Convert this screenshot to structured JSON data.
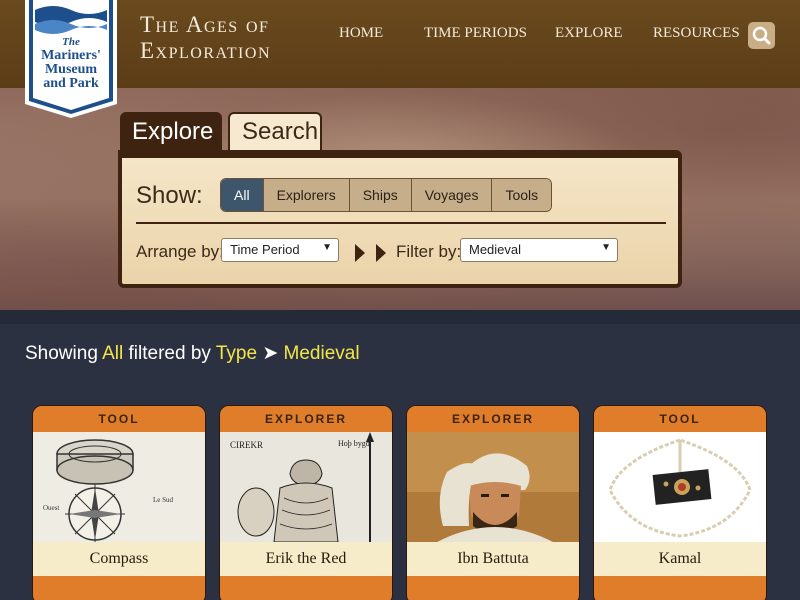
{
  "logo": {
    "lines": [
      "The",
      "Mariners'",
      "Museum",
      "and Park"
    ]
  },
  "site_title": {
    "line1": "The Ages of",
    "line2": "Exploration"
  },
  "nav": {
    "items": [
      {
        "label": "HOME"
      },
      {
        "label": "TIME PERIODS"
      },
      {
        "label": "EXPLORE"
      },
      {
        "label": "RESOURCES"
      }
    ],
    "search_icon": "search-icon"
  },
  "tabs": {
    "explore": "Explore",
    "search": "Search"
  },
  "panel": {
    "show_label": "Show:",
    "filters": [
      "All",
      "Explorers",
      "Ships",
      "Voyages",
      "Tools"
    ],
    "active_filter": "All",
    "arrange_label": "Arrange by:",
    "arrange_value": "Time Period",
    "filter_label": "Filter by:",
    "filter_value": "Medieval"
  },
  "results": {
    "prefix": "Showing",
    "show": "All",
    "middle": "filtered by",
    "type": "Type",
    "separator": "➤",
    "period": "Medieval"
  },
  "cards": [
    {
      "type": "TOOL",
      "name": "Compass"
    },
    {
      "type": "EXPLORER",
      "name": "Erik the Red"
    },
    {
      "type": "EXPLORER",
      "name": "Ibn Battuta"
    },
    {
      "type": "TOOL",
      "name": "Kamal"
    }
  ],
  "colors": {
    "header": "#5b3d17",
    "accent_yellow": "#f3e64a",
    "card_orange": "#e07d2a",
    "active_filter": "#3d566b"
  }
}
